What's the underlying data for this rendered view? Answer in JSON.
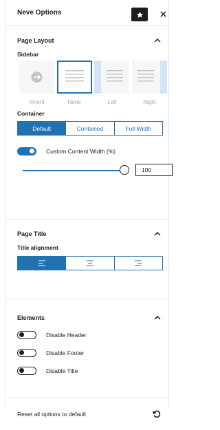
{
  "header": {
    "title": "Neve Options",
    "star_icon": "star-icon",
    "close_icon": "close-icon"
  },
  "page_layout": {
    "title": "Page Layout",
    "sidebar_label": "Sidebar",
    "options": [
      {
        "label": "Inherit",
        "icon": "inherit-icon"
      },
      {
        "label": "None",
        "selected": true
      },
      {
        "label": "Left"
      },
      {
        "label": "Right"
      }
    ],
    "container_label": "Container",
    "container_options": [
      "Default",
      "Contained",
      "Full Width"
    ],
    "container_selected": "Default",
    "custom_width_label": "Custom Content Width (%)",
    "custom_width_enabled": true,
    "custom_width_value": "100"
  },
  "page_title": {
    "title": "Page Title",
    "alignment_label": "Title alignment",
    "alignment_options": [
      "align-left-icon",
      "align-center-icon",
      "align-right-icon"
    ],
    "alignment_selected": "align-left-icon"
  },
  "elements": {
    "title": "Elements",
    "toggles": [
      {
        "label": "Disable Header",
        "enabled": false
      },
      {
        "label": "Disable Footer",
        "enabled": false
      },
      {
        "label": "Disable Title",
        "enabled": false
      }
    ]
  },
  "footer": {
    "reset_label": "Reset all options to default",
    "reset_icon": "reset-icon"
  },
  "colors": {
    "accent": "#2271b1",
    "text": "#1e1e1e",
    "muted": "#a0a5aa",
    "sidebar_fill": "#d4e4f7"
  }
}
